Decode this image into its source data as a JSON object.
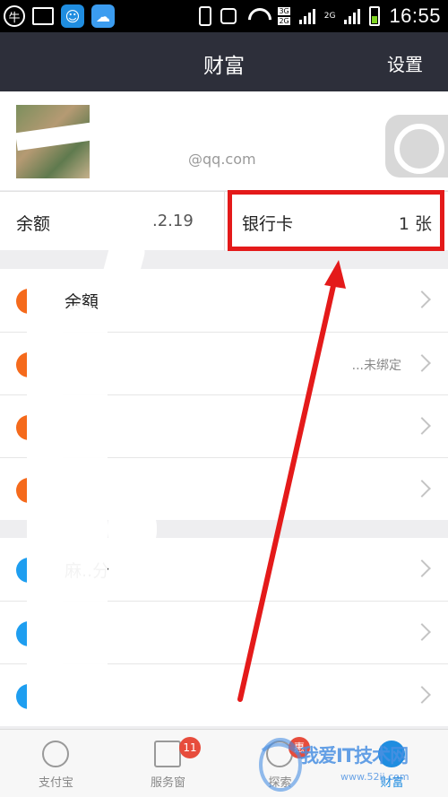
{
  "status_bar": {
    "time": "16:55",
    "app_icons": [
      "ox-icon",
      "gallery-icon",
      "qq-icon",
      "cloud-icon"
    ],
    "network": [
      "3G",
      "2G"
    ],
    "network2": "2G"
  },
  "header": {
    "title": "财富",
    "settings_label": "设置"
  },
  "profile": {
    "email": "@qq.com"
  },
  "balance": {
    "label": "余额",
    "value": ".2.19"
  },
  "bank_card": {
    "label": "银行卡",
    "count": "1 张"
  },
  "menu_group_1": [
    {
      "label": "余額",
      "icon_color": "#f56a1c",
      "status": ""
    },
    {
      "label": "",
      "icon_color": "#f56a1c",
      "status": "...未绑定"
    },
    {
      "label": "",
      "icon_color": "#f56a1c",
      "status": ""
    },
    {
      "label": "",
      "icon_color": "#f56a1c",
      "status": ""
    }
  ],
  "menu_group_2": [
    {
      "label": "麻..分",
      "icon_color": "#1e9ef0",
      "status": ""
    },
    {
      "label": "",
      "icon_color": "#1e9ef0",
      "status": ""
    },
    {
      "label": "",
      "icon_color": "#1e9ef0",
      "status": ""
    }
  ],
  "tabs": [
    {
      "label": "支付宝",
      "badge": ""
    },
    {
      "label": "服务窗",
      "badge": "11"
    },
    {
      "label": "探索",
      "badge": "惠"
    },
    {
      "label": "财富",
      "badge": ""
    }
  ],
  "watermark": {
    "text": "我爱IT技术网",
    "url": "www.52ij.com"
  },
  "colors": {
    "header_bg": "#2d2f3a",
    "annotation_red": "#e41a1a",
    "accent_blue": "#1f8de0",
    "menu_orange": "#f56a1c"
  }
}
